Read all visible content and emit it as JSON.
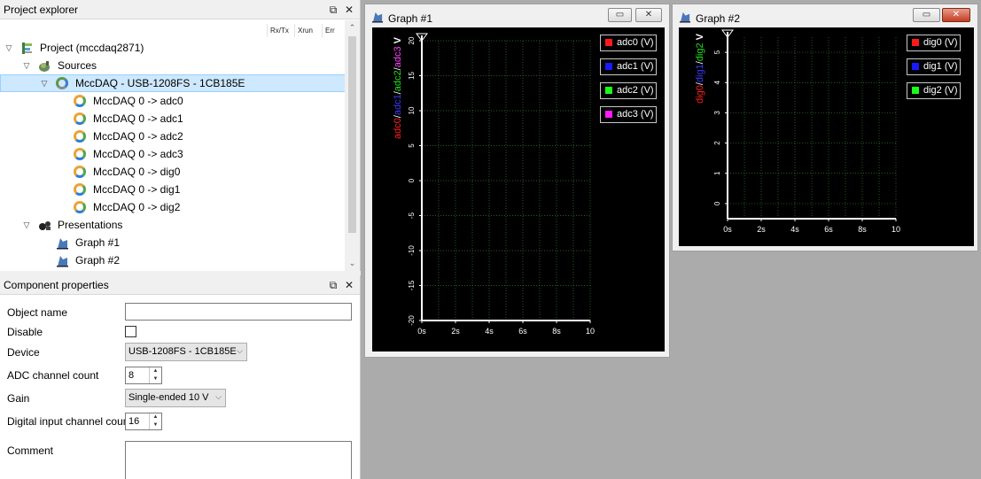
{
  "explorer": {
    "title": "Project explorer",
    "columns": [
      "Rx/Tx",
      "Xrun",
      "Err"
    ],
    "tree": {
      "project": "Project (mccdaq2871)",
      "sources_label": "Sources",
      "device": "MccDAQ - USB-1208FS - 1CB185E",
      "channels": [
        "MccDAQ 0 -> adc0",
        "MccDAQ 0 -> adc1",
        "MccDAQ 0 -> adc2",
        "MccDAQ 0 -> adc3",
        "MccDAQ 0 -> dig0",
        "MccDAQ 0 -> dig1",
        "MccDAQ 0 -> dig2"
      ],
      "presentations_label": "Presentations",
      "presentations": [
        "Graph #1",
        "Graph #2"
      ]
    }
  },
  "props": {
    "title": "Component properties",
    "labels": {
      "object_name": "Object name",
      "disable": "Disable",
      "device": "Device",
      "adc_count": "ADC channel count",
      "gain": "Gain",
      "dig_count": "Digital input channel count",
      "comment": "Comment"
    },
    "values": {
      "object_name": "",
      "disable": false,
      "device": "USB-1208FS - 1CB185E",
      "adc_count": "8",
      "gain": "Single-ended 10 V",
      "dig_count": "16",
      "comment": ""
    }
  },
  "graph1": {
    "title": "Graph #1",
    "ylabel_series": [
      {
        "text": "adc0",
        "color": "#ff2020"
      },
      {
        "text": "/",
        "color": "#ffffff"
      },
      {
        "text": "adc1",
        "color": "#3a3aff"
      },
      {
        "text": "/",
        "color": "#ffffff"
      },
      {
        "text": "adc2",
        "color": "#20e020"
      },
      {
        "text": "/",
        "color": "#ffffff"
      },
      {
        "text": "adc3",
        "color": "#ff40ff"
      }
    ],
    "ylabel_unit": " V",
    "y_ticks": [
      "20",
      "15",
      "10",
      "5",
      "0",
      "-5",
      "-10",
      "-15",
      "-20"
    ],
    "x_ticks": [
      "0s",
      "2s",
      "4s",
      "6s",
      "8s",
      "10"
    ],
    "legend": [
      {
        "label": "adc0 (V)",
        "color": "#ff1a1a"
      },
      {
        "label": "adc1 (V)",
        "color": "#1a1aff"
      },
      {
        "label": "adc2 (V)",
        "color": "#1aff1a"
      },
      {
        "label": "adc3 (V)",
        "color": "#ff1aff"
      }
    ]
  },
  "graph2": {
    "title": "Graph #2",
    "ylabel_series": [
      {
        "text": "dig0",
        "color": "#ff2020"
      },
      {
        "text": "/",
        "color": "#ffffff"
      },
      {
        "text": "dig1",
        "color": "#3a3aff"
      },
      {
        "text": "/",
        "color": "#ffffff"
      },
      {
        "text": "dig2",
        "color": "#20e020"
      }
    ],
    "ylabel_unit": " V",
    "y_ticks": [
      "5",
      "4",
      "3",
      "2",
      "1",
      "0"
    ],
    "x_ticks": [
      "0s",
      "2s",
      "4s",
      "6s",
      "8s",
      "10"
    ],
    "legend": [
      {
        "label": "dig0 (V)",
        "color": "#ff1a1a"
      },
      {
        "label": "dig1 (V)",
        "color": "#1a1aff"
      },
      {
        "label": "dig2 (V)",
        "color": "#1aff1a"
      }
    ]
  },
  "chart_data": [
    {
      "type": "line",
      "title": "",
      "xlabel": "",
      "ylabel": "adc0/adc1/adc2/adc3 V",
      "x_ticks": [
        "0s",
        "2s",
        "4s",
        "6s",
        "8s",
        "10"
      ],
      "y_ticks": [
        20,
        15,
        10,
        5,
        0,
        -5,
        -10,
        -15,
        -20
      ],
      "xlim": [
        0,
        10
      ],
      "ylim": [
        -20,
        20
      ],
      "grid": true,
      "legend_position": "top-right",
      "series": [
        {
          "name": "adc0 (V)",
          "values": []
        },
        {
          "name": "adc1 (V)",
          "values": []
        },
        {
          "name": "adc2 (V)",
          "values": []
        },
        {
          "name": "adc3 (V)",
          "values": []
        }
      ]
    },
    {
      "type": "line",
      "title": "",
      "xlabel": "",
      "ylabel": "dig0/dig1/dig2 V",
      "x_ticks": [
        "0s",
        "2s",
        "4s",
        "6s",
        "8s",
        "10"
      ],
      "y_ticks": [
        5,
        4,
        3,
        2,
        1,
        0
      ],
      "xlim": [
        0,
        10
      ],
      "ylim": [
        -0.5,
        5.5
      ],
      "grid": true,
      "legend_position": "top-right",
      "series": [
        {
          "name": "dig0 (V)",
          "values": []
        },
        {
          "name": "dig1 (V)",
          "values": []
        },
        {
          "name": "dig2 (V)",
          "values": []
        }
      ]
    }
  ]
}
